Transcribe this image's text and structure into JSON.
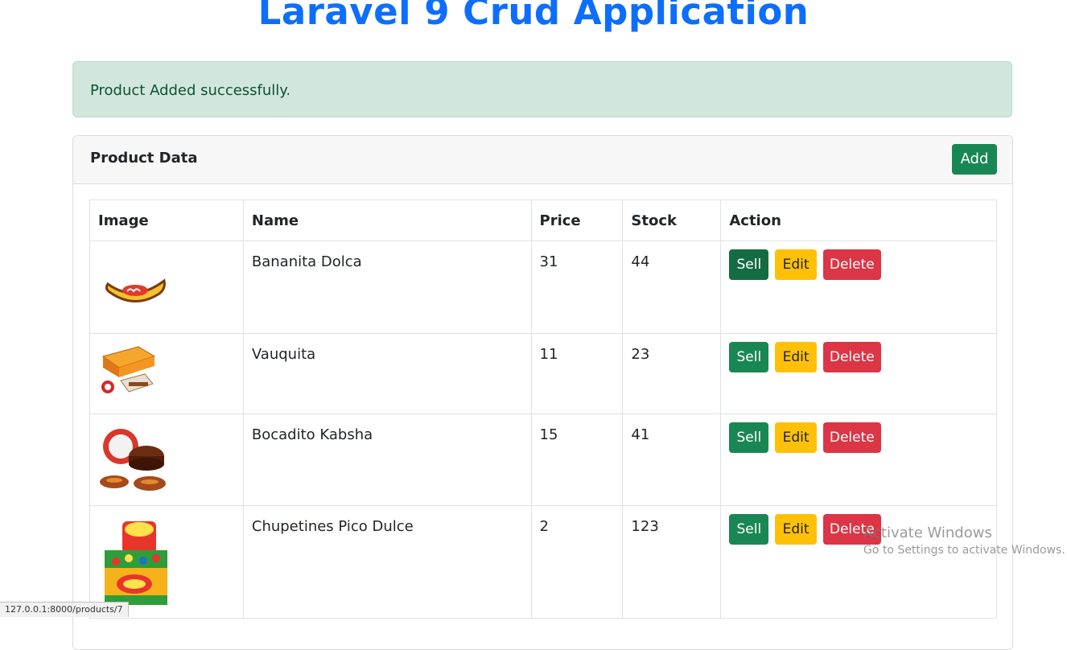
{
  "page": {
    "title": "Laravel 9 Crud Application"
  },
  "alert": {
    "message": "Product Added successfully."
  },
  "card": {
    "title": "Product Data",
    "add_label": "Add"
  },
  "table": {
    "headers": [
      "Image",
      "Name",
      "Price",
      "Stock",
      "Action"
    ],
    "rows": [
      {
        "name": "Bananita Dolca",
        "price": "31",
        "stock": "44",
        "image_icon": "bananita-product-image"
      },
      {
        "name": "Vauquita",
        "price": "11",
        "stock": "23",
        "image_icon": "vauquita-product-image"
      },
      {
        "name": "Bocadito Kabsha",
        "price": "15",
        "stock": "41",
        "image_icon": "kabsha-product-image"
      },
      {
        "name": "Chupetines Pico Dulce",
        "price": "2",
        "stock": "123",
        "image_icon": "pico-dulce-product-image"
      }
    ],
    "actions": {
      "sell": "Sell",
      "edit": "Edit",
      "delete": "Delete"
    }
  },
  "status_bar": {
    "url": "127.0.0.1:8000/products/7"
  },
  "watermark": {
    "line1": "Activate Windows",
    "line2": "Go to Settings to activate Windows."
  },
  "colors": {
    "primary": "#0d6efd",
    "success": "#198754",
    "warning": "#ffc107",
    "danger": "#dc3545",
    "alert_bg": "#d1e7dd"
  }
}
